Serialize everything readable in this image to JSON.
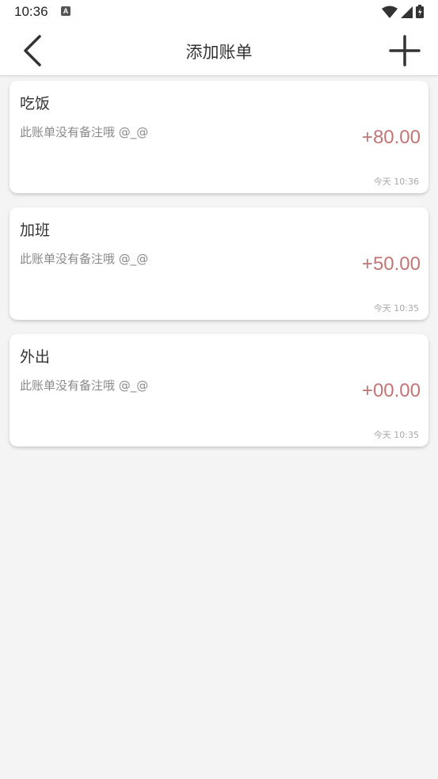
{
  "status_bar": {
    "time": "10:36",
    "notification_icon": "a-icon",
    "icons": [
      "wifi-icon",
      "cellular-signal-icon",
      "battery-icon"
    ]
  },
  "header": {
    "title": "添加账单",
    "back_icon": "chevron-left-icon",
    "add_icon": "plus-icon"
  },
  "colors": {
    "amount": "#c27575",
    "background": "#f4f4f4",
    "card": "#ffffff"
  },
  "bills": [
    {
      "name": "吃饭",
      "note": "此账单没有备注哦 @_@",
      "amount": "+80.00",
      "time": "今天 10:36"
    },
    {
      "name": "加班",
      "note": "此账单没有备注哦 @_@",
      "amount": "+50.00",
      "time": "今天 10:35"
    },
    {
      "name": "外出",
      "note": "此账单没有备注哦 @_@",
      "amount": "+00.00",
      "time": "今天 10:35"
    }
  ]
}
